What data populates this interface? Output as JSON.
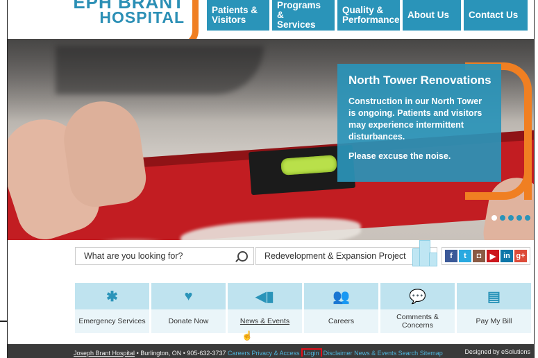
{
  "header": {
    "logo_top": "JOSEPH BRANT",
    "logo_main": "HOSPITAL",
    "nav": [
      {
        "line1": "Patients &",
        "line2": "Visitors"
      },
      {
        "line1": "Programs &",
        "line2": "Services"
      },
      {
        "line1": "Quality &",
        "line2": "Performance"
      },
      {
        "line1": "About Us",
        "line2": ""
      },
      {
        "line1": "Contact Us",
        "line2": ""
      }
    ]
  },
  "hero": {
    "title": "North Tower Renovations",
    "body": "Construction in our North Tower is ongoing. Patients and visitors may experience intermittent disturbances.",
    "note": "Please excuse the noise."
  },
  "search": {
    "placeholder": "What are you looking for?",
    "redevelopment_label": "Redevelopment & Expansion Project"
  },
  "social": [
    {
      "name": "facebook",
      "glyph": "f",
      "color": "#3b5998"
    },
    {
      "name": "twitter",
      "glyph": "t",
      "color": "#2aa9e0"
    },
    {
      "name": "instagram",
      "glyph": "◘",
      "color": "#8a5a44"
    },
    {
      "name": "youtube",
      "glyph": "▶",
      "color": "#cc181e"
    },
    {
      "name": "linkedin",
      "glyph": "in",
      "color": "#0e76a8"
    },
    {
      "name": "googleplus",
      "glyph": "g+",
      "color": "#dd4b39"
    }
  ],
  "tiles": [
    {
      "label": "Emergency Services",
      "icon": "asterisk-icon"
    },
    {
      "label": "Donate Now",
      "icon": "heart-hands-icon"
    },
    {
      "label": "News & Events",
      "icon": "megaphone-icon"
    },
    {
      "label": "Careers",
      "icon": "people-icon"
    },
    {
      "label": "Comments & Concerns",
      "icon": "speech-person-icon"
    },
    {
      "label": "Pay My Bill",
      "icon": "wallet-icon"
    }
  ],
  "footer": {
    "org": "Joseph Brant Hospital",
    "location": "Burlington, ON",
    "phone": "905-632-3737",
    "links": [
      "Careers",
      "Privacy & Access",
      "Login",
      "Disclaimer",
      "News & Events",
      "Search",
      "Sitemap"
    ],
    "credit": "Designed by eSolutions"
  },
  "colors": {
    "brand_blue": "#2a94b9",
    "brand_orange": "#f07f22",
    "highlight_red": "#e2101b"
  }
}
